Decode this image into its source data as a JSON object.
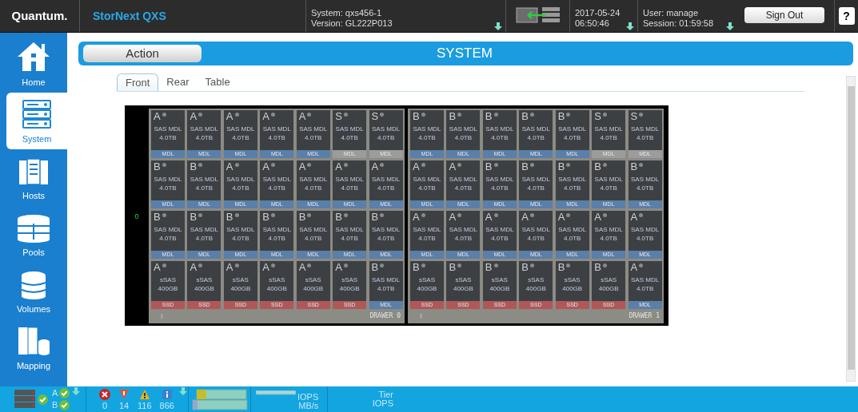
{
  "header": {
    "brand": "Quantum.",
    "product": "StorNext QXS",
    "system": "System: qxs456-1",
    "version": "Version: GL222P013",
    "date": "2017-05-24",
    "time": "06:50:46",
    "user": "User: manage",
    "session": "Session: 01:59:58",
    "sign_out": "Sign Out",
    "help": "?"
  },
  "sidebar": {
    "items": [
      {
        "label": "Home",
        "kind": "home",
        "selected": false
      },
      {
        "label": "System",
        "kind": "system",
        "selected": true
      },
      {
        "label": "Hosts",
        "kind": "hosts",
        "selected": false
      },
      {
        "label": "Pools",
        "kind": "pools",
        "selected": false
      },
      {
        "label": "Volumes",
        "kind": "volumes",
        "selected": false
      },
      {
        "label": "Mapping",
        "kind": "mapping",
        "selected": false
      }
    ]
  },
  "action_button": "Action",
  "page_title": "SYSTEM",
  "tabs": [
    {
      "label": "Front",
      "selected": true
    },
    {
      "label": "Rear",
      "selected": false
    },
    {
      "label": "Table",
      "selected": false
    }
  ],
  "enclosure": {
    "index": "0",
    "drawers": [
      {
        "label": "DRAWER 0",
        "drives": [
          {
            "letter": "A",
            "type": "SAS MDL",
            "size": "4.0TB",
            "tier": "MDL",
            "color": "#5a7fa8"
          },
          {
            "letter": "A",
            "type": "SAS MDL",
            "size": "4.0TB",
            "tier": "MDL",
            "color": "#5a7fa8"
          },
          {
            "letter": "A",
            "type": "SAS MDL",
            "size": "4.0TB",
            "tier": "MDL",
            "color": "#5a7fa8"
          },
          {
            "letter": "A",
            "type": "SAS MDL",
            "size": "4.0TB",
            "tier": "MDL",
            "color": "#5a7fa8"
          },
          {
            "letter": "A",
            "type": "SAS MDL",
            "size": "4.0TB",
            "tier": "MDL",
            "color": "#5a7fa8"
          },
          {
            "letter": "S",
            "type": "SAS MDL",
            "size": "4.0TB",
            "tier": "MDL",
            "color": "#9c9c9c"
          },
          {
            "letter": "S",
            "type": "SAS MDL",
            "size": "4.0TB",
            "tier": "MDL",
            "color": "#9c9c9c"
          },
          {
            "letter": "B",
            "type": "SAS MDL",
            "size": "4.0TB",
            "tier": "MDL",
            "color": "#5a7fa8"
          },
          {
            "letter": "B",
            "type": "SAS MDL",
            "size": "4.0TB",
            "tier": "MDL",
            "color": "#5a7fa8"
          },
          {
            "letter": "A",
            "type": "SAS MDL",
            "size": "4.0TB",
            "tier": "MDL",
            "color": "#5a7fa8"
          },
          {
            "letter": "A",
            "type": "SAS MDL",
            "size": "4.0TB",
            "tier": "MDL",
            "color": "#5a7fa8"
          },
          {
            "letter": "A",
            "type": "SAS MDL",
            "size": "4.0TB",
            "tier": "MDL",
            "color": "#5a7fa8"
          },
          {
            "letter": "A",
            "type": "SAS MDL",
            "size": "4.0TB",
            "tier": "MDL",
            "color": "#5a7fa8"
          },
          {
            "letter": "A",
            "type": "SAS MDL",
            "size": "4.0TB",
            "tier": "MDL",
            "color": "#5a7fa8"
          },
          {
            "letter": "B",
            "type": "SAS MDL",
            "size": "4.0TB",
            "tier": "MDL",
            "color": "#5a7fa8"
          },
          {
            "letter": "B",
            "type": "SAS MDL",
            "size": "4.0TB",
            "tier": "MDL",
            "color": "#5a7fa8"
          },
          {
            "letter": "B",
            "type": "SAS MDL",
            "size": "4.0TB",
            "tier": "MDL",
            "color": "#5a7fa8"
          },
          {
            "letter": "B",
            "type": "SAS MDL",
            "size": "4.0TB",
            "tier": "MDL",
            "color": "#5a7fa8"
          },
          {
            "letter": "B",
            "type": "SAS MDL",
            "size": "4.0TB",
            "tier": "MDL",
            "color": "#5a7fa8"
          },
          {
            "letter": "B",
            "type": "SAS MDL",
            "size": "4.0TB",
            "tier": "MDL",
            "color": "#5a7fa8"
          },
          {
            "letter": "B",
            "type": "SAS MDL",
            "size": "4.0TB",
            "tier": "MDL",
            "color": "#5a7fa8"
          },
          {
            "letter": "A",
            "type": "sSAS",
            "size": "400GB",
            "tier": "SSD",
            "color": "#b05858"
          },
          {
            "letter": "A",
            "type": "sSAS",
            "size": "400GB",
            "tier": "SSD",
            "color": "#b05858"
          },
          {
            "letter": "A",
            "type": "sSAS",
            "size": "400GB",
            "tier": "SSD",
            "color": "#b05858"
          },
          {
            "letter": "A",
            "type": "sSAS",
            "size": "400GB",
            "tier": "SSD",
            "color": "#b05858"
          },
          {
            "letter": "A",
            "type": "sSAS",
            "size": "400GB",
            "tier": "SSD",
            "color": "#b05858"
          },
          {
            "letter": "A",
            "type": "sSAS",
            "size": "400GB",
            "tier": "SSD",
            "color": "#b05858"
          },
          {
            "letter": "B",
            "type": "SAS MDL",
            "size": "4.0TB",
            "tier": "MDL",
            "color": "#5a7fa8"
          }
        ]
      },
      {
        "label": "DRAWER 1",
        "drives": [
          {
            "letter": "B",
            "type": "SAS MDL",
            "size": "4.0TB",
            "tier": "MDL",
            "color": "#5a7fa8"
          },
          {
            "letter": "B",
            "type": "SAS MDL",
            "size": "4.0TB",
            "tier": "MDL",
            "color": "#5a7fa8"
          },
          {
            "letter": "B",
            "type": "SAS MDL",
            "size": "4.0TB",
            "tier": "MDL",
            "color": "#5a7fa8"
          },
          {
            "letter": "B",
            "type": "SAS MDL",
            "size": "4.0TB",
            "tier": "MDL",
            "color": "#5a7fa8"
          },
          {
            "letter": "B",
            "type": "SAS MDL",
            "size": "4.0TB",
            "tier": "MDL",
            "color": "#5a7fa8"
          },
          {
            "letter": "S",
            "type": "SAS MDL",
            "size": "4.0TB",
            "tier": "MDL",
            "color": "#9c9c9c"
          },
          {
            "letter": "S",
            "type": "SAS MDL",
            "size": "4.0TB",
            "tier": "MDL",
            "color": "#9c9c9c"
          },
          {
            "letter": "A",
            "type": "SAS MDL",
            "size": "4.0TB",
            "tier": "MDL",
            "color": "#5a7fa8"
          },
          {
            "letter": "A",
            "type": "SAS MDL",
            "size": "4.0TB",
            "tier": "MDL",
            "color": "#5a7fa8"
          },
          {
            "letter": "B",
            "type": "SAS MDL",
            "size": "4.0TB",
            "tier": "MDL",
            "color": "#5a7fa8"
          },
          {
            "letter": "B",
            "type": "SAS MDL",
            "size": "4.0TB",
            "tier": "MDL",
            "color": "#5a7fa8"
          },
          {
            "letter": "B",
            "type": "SAS MDL",
            "size": "4.0TB",
            "tier": "MDL",
            "color": "#5a7fa8"
          },
          {
            "letter": "B",
            "type": "SAS MDL",
            "size": "4.0TB",
            "tier": "MDL",
            "color": "#5a7fa8"
          },
          {
            "letter": "B",
            "type": "SAS MDL",
            "size": "4.0TB",
            "tier": "MDL",
            "color": "#5a7fa8"
          },
          {
            "letter": "A",
            "type": "SAS MDL",
            "size": "4.0TB",
            "tier": "MDL",
            "color": "#5a7fa8"
          },
          {
            "letter": "A",
            "type": "SAS MDL",
            "size": "4.0TB",
            "tier": "MDL",
            "color": "#5a7fa8"
          },
          {
            "letter": "A",
            "type": "SAS MDL",
            "size": "4.0TB",
            "tier": "MDL",
            "color": "#5a7fa8"
          },
          {
            "letter": "A",
            "type": "SAS MDL",
            "size": "4.0TB",
            "tier": "MDL",
            "color": "#5a7fa8"
          },
          {
            "letter": "A",
            "type": "SAS MDL",
            "size": "4.0TB",
            "tier": "MDL",
            "color": "#5a7fa8"
          },
          {
            "letter": "A",
            "type": "SAS MDL",
            "size": "4.0TB",
            "tier": "MDL",
            "color": "#5a7fa8"
          },
          {
            "letter": "A",
            "type": "SAS MDL",
            "size": "4.0TB",
            "tier": "MDL",
            "color": "#5a7fa8"
          },
          {
            "letter": "B",
            "type": "sSAS",
            "size": "400GB",
            "tier": "SSD",
            "color": "#b05858"
          },
          {
            "letter": "B",
            "type": "sSAS",
            "size": "400GB",
            "tier": "SSD",
            "color": "#b05858"
          },
          {
            "letter": "B",
            "type": "sSAS",
            "size": "400GB",
            "tier": "SSD",
            "color": "#b05858"
          },
          {
            "letter": "B",
            "type": "sSAS",
            "size": "400GB",
            "tier": "SSD",
            "color": "#b05858"
          },
          {
            "letter": "B",
            "type": "sSAS",
            "size": "400GB",
            "tier": "SSD",
            "color": "#b05858"
          },
          {
            "letter": "B",
            "type": "sSAS",
            "size": "400GB",
            "tier": "SSD",
            "color": "#b05858"
          },
          {
            "letter": "A",
            "type": "SAS MDL",
            "size": "4.0TB",
            "tier": "MDL",
            "color": "#5a7fa8"
          }
        ]
      }
    ]
  },
  "status_bar": {
    "controller_a": "A",
    "controller_b": "B",
    "alerts": [
      {
        "kind": "critical",
        "count": "0"
      },
      {
        "kind": "error",
        "count": "14"
      },
      {
        "kind": "warning",
        "count": "116"
      },
      {
        "kind": "info",
        "count": "866"
      }
    ],
    "perf_labels": [
      "IOPS",
      "MB/s"
    ],
    "tier_labels": [
      "Tier",
      "IOPS"
    ]
  }
}
